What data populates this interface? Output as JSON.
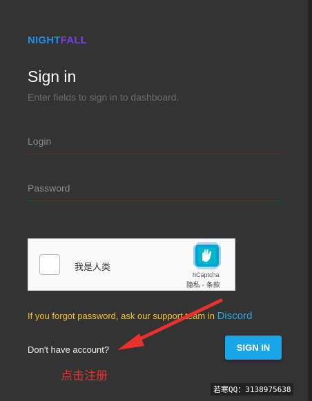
{
  "brand": {
    "part1": "NIGHT",
    "part2": "FALL"
  },
  "signin_form": {
    "title": "Sign in",
    "subtitle": "Enter fields to sign in to dashboard.",
    "login_placeholder": "Login",
    "password_placeholder": "Password"
  },
  "captcha": {
    "checkbox_label": "我是人类",
    "brand": "hCaptcha",
    "links": "隐私 - 条款"
  },
  "help": {
    "forgot_text": "If you forgot password, ask our support team in ",
    "discord_link": "Discord"
  },
  "register": {
    "prompt": "Don't have account?",
    "annotation": "点击注册"
  },
  "actions": {
    "signin_label": "SIGN IN"
  },
  "watermark": "若寒QQ：3138975638",
  "colors": {
    "background": "#333333",
    "accent_blue": "#18a6e8",
    "brand_blue": "#1e8fe8",
    "brand_purple": "#7b3fe4",
    "field_underline": "#8e1b1b",
    "warning_yellow": "#f2c13a",
    "annotation_red": "#e8302c"
  }
}
